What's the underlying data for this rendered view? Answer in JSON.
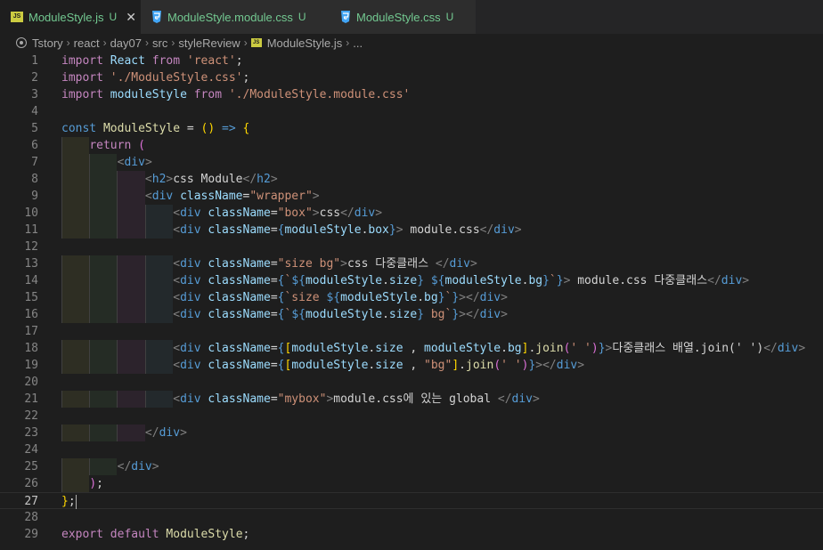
{
  "tabs": [
    {
      "label": "ModuleStyle.js",
      "badge": "U",
      "icon": "js-file-icon",
      "active": true,
      "close": "✕"
    },
    {
      "label": "ModuleStyle.module.css",
      "badge": "U",
      "icon": "css-file-icon",
      "active": false
    },
    {
      "label": "ModuleStyle.css",
      "badge": "U",
      "icon": "css-file-icon",
      "active": false
    }
  ],
  "breadcrumb": [
    "Tstory",
    "react",
    "day07",
    "src",
    "styleReview",
    "ModuleStyle.js",
    "..."
  ],
  "colors": {
    "editor_bg": "#1e1e1e",
    "tab_modified": "#73c991",
    "keyword": "#c586c0",
    "string": "#ce9178",
    "variable": "#9cdcfe"
  },
  "current_line": 27,
  "lines": [
    {
      "n": "1",
      "tokens": [
        [
          "kw",
          "import"
        ],
        [
          "txt",
          " "
        ],
        [
          "var",
          "React"
        ],
        [
          "txt",
          " "
        ],
        [
          "kw",
          "from"
        ],
        [
          "txt",
          " "
        ],
        [
          "str",
          "'react'"
        ],
        [
          "txt",
          ";"
        ]
      ]
    },
    {
      "n": "2",
      "tokens": [
        [
          "kw",
          "import"
        ],
        [
          "txt",
          " "
        ],
        [
          "str",
          "'./ModuleStyle.css'"
        ],
        [
          "txt",
          ";"
        ]
      ]
    },
    {
      "n": "3",
      "tokens": [
        [
          "kw",
          "import"
        ],
        [
          "txt",
          " "
        ],
        [
          "var",
          "moduleStyle"
        ],
        [
          "txt",
          " "
        ],
        [
          "kw",
          "from"
        ],
        [
          "txt",
          " "
        ],
        [
          "str",
          "'./ModuleStyle.module.css'"
        ]
      ]
    },
    {
      "n": "4",
      "tokens": []
    },
    {
      "n": "5",
      "tokens": [
        [
          "kw2",
          "const"
        ],
        [
          "txt",
          " "
        ],
        [
          "fn",
          "ModuleStyle"
        ],
        [
          "txt",
          " = "
        ],
        [
          "brk",
          "()"
        ],
        [
          "txt",
          " "
        ],
        [
          "kw2",
          "=>"
        ],
        [
          "txt",
          " "
        ],
        [
          "brk",
          "{"
        ]
      ]
    },
    {
      "n": "6",
      "tokens": [
        [
          "txt",
          "    "
        ],
        [
          "kw",
          "return"
        ],
        [
          "txt",
          " "
        ],
        [
          "brk2",
          "("
        ]
      ]
    },
    {
      "n": "7",
      "tokens": [
        [
          "txt",
          "        "
        ],
        [
          "ang",
          "<"
        ],
        [
          "tag",
          "div"
        ],
        [
          "ang",
          ">"
        ]
      ]
    },
    {
      "n": "8",
      "tokens": [
        [
          "txt",
          "            "
        ],
        [
          "ang",
          "<"
        ],
        [
          "tag",
          "h2"
        ],
        [
          "ang",
          ">"
        ],
        [
          "txt",
          "css Module"
        ],
        [
          "ang",
          "</"
        ],
        [
          "tag",
          "h2"
        ],
        [
          "ang",
          ">"
        ]
      ]
    },
    {
      "n": "9",
      "tokens": [
        [
          "txt",
          "            "
        ],
        [
          "ang",
          "<"
        ],
        [
          "tag",
          "div"
        ],
        [
          "txt",
          " "
        ],
        [
          "attr",
          "className"
        ],
        [
          "txt",
          "="
        ],
        [
          "str",
          "\"wrapper\""
        ],
        [
          "ang",
          ">"
        ]
      ]
    },
    {
      "n": "10",
      "tokens": [
        [
          "txt",
          "                "
        ],
        [
          "ang",
          "<"
        ],
        [
          "tag",
          "div"
        ],
        [
          "txt",
          " "
        ],
        [
          "attr",
          "className"
        ],
        [
          "txt",
          "="
        ],
        [
          "str",
          "\"box\""
        ],
        [
          "ang",
          ">"
        ],
        [
          "txt",
          "css"
        ],
        [
          "ang",
          "</"
        ],
        [
          "tag",
          "div"
        ],
        [
          "ang",
          ">"
        ]
      ]
    },
    {
      "n": "11",
      "tokens": [
        [
          "txt",
          "                "
        ],
        [
          "ang",
          "<"
        ],
        [
          "tag",
          "div"
        ],
        [
          "txt",
          " "
        ],
        [
          "attr",
          "className"
        ],
        [
          "txt",
          "="
        ],
        [
          "tpl",
          "{"
        ],
        [
          "var",
          "moduleStyle"
        ],
        [
          "txt",
          "."
        ],
        [
          "var",
          "box"
        ],
        [
          "tpl",
          "}"
        ],
        [
          "ang",
          ">"
        ],
        [
          "txt",
          " module.css"
        ],
        [
          "ang",
          "</"
        ],
        [
          "tag",
          "div"
        ],
        [
          "ang",
          ">"
        ]
      ]
    },
    {
      "n": "12",
      "tokens": []
    },
    {
      "n": "13",
      "tokens": [
        [
          "txt",
          "                "
        ],
        [
          "ang",
          "<"
        ],
        [
          "tag",
          "div"
        ],
        [
          "txt",
          " "
        ],
        [
          "attr",
          "className"
        ],
        [
          "txt",
          "="
        ],
        [
          "str",
          "\"size bg\""
        ],
        [
          "ang",
          ">"
        ],
        [
          "txt",
          "css 다중클래스 "
        ],
        [
          "ang",
          "</"
        ],
        [
          "tag",
          "div"
        ],
        [
          "ang",
          ">"
        ]
      ]
    },
    {
      "n": "14",
      "tokens": [
        [
          "txt",
          "                "
        ],
        [
          "ang",
          "<"
        ],
        [
          "tag",
          "div"
        ],
        [
          "txt",
          " "
        ],
        [
          "attr",
          "className"
        ],
        [
          "txt",
          "="
        ],
        [
          "tpl",
          "{"
        ],
        [
          "str",
          "`"
        ],
        [
          "tpl",
          "${"
        ],
        [
          "var",
          "moduleStyle"
        ],
        [
          "txt",
          "."
        ],
        [
          "var",
          "size"
        ],
        [
          "tpl",
          "}"
        ],
        [
          "str",
          " "
        ],
        [
          "tpl",
          "${"
        ],
        [
          "var",
          "moduleStyle"
        ],
        [
          "txt",
          "."
        ],
        [
          "var",
          "bg"
        ],
        [
          "tpl",
          "}"
        ],
        [
          "str",
          "`"
        ],
        [
          "tpl",
          "}"
        ],
        [
          "ang",
          ">"
        ],
        [
          "txt",
          " module.css 다중클래스"
        ],
        [
          "ang",
          "</"
        ],
        [
          "tag",
          "div"
        ],
        [
          "ang",
          ">"
        ]
      ]
    },
    {
      "n": "15",
      "tokens": [
        [
          "txt",
          "                "
        ],
        [
          "ang",
          "<"
        ],
        [
          "tag",
          "div"
        ],
        [
          "txt",
          " "
        ],
        [
          "attr",
          "className"
        ],
        [
          "txt",
          "="
        ],
        [
          "tpl",
          "{"
        ],
        [
          "str",
          "`size "
        ],
        [
          "tpl",
          "${"
        ],
        [
          "var",
          "moduleStyle"
        ],
        [
          "txt",
          "."
        ],
        [
          "var",
          "bg"
        ],
        [
          "tpl",
          "}"
        ],
        [
          "str",
          "`"
        ],
        [
          "tpl",
          "}"
        ],
        [
          "ang",
          "></"
        ],
        [
          "tag",
          "div"
        ],
        [
          "ang",
          ">"
        ]
      ]
    },
    {
      "n": "16",
      "tokens": [
        [
          "txt",
          "                "
        ],
        [
          "ang",
          "<"
        ],
        [
          "tag",
          "div"
        ],
        [
          "txt",
          " "
        ],
        [
          "attr",
          "className"
        ],
        [
          "txt",
          "="
        ],
        [
          "tpl",
          "{"
        ],
        [
          "str",
          "`"
        ],
        [
          "tpl",
          "${"
        ],
        [
          "var",
          "moduleStyle"
        ],
        [
          "txt",
          "."
        ],
        [
          "var",
          "size"
        ],
        [
          "tpl",
          "}"
        ],
        [
          "str",
          " bg`"
        ],
        [
          "tpl",
          "}"
        ],
        [
          "ang",
          "></"
        ],
        [
          "tag",
          "div"
        ],
        [
          "ang",
          ">"
        ]
      ]
    },
    {
      "n": "17",
      "tokens": []
    },
    {
      "n": "18",
      "tokens": [
        [
          "txt",
          "                "
        ],
        [
          "ang",
          "<"
        ],
        [
          "tag",
          "div"
        ],
        [
          "txt",
          " "
        ],
        [
          "attr",
          "className"
        ],
        [
          "txt",
          "="
        ],
        [
          "tpl",
          "{"
        ],
        [
          "brk",
          "["
        ],
        [
          "var",
          "moduleStyle"
        ],
        [
          "txt",
          "."
        ],
        [
          "var",
          "size"
        ],
        [
          "txt",
          " , "
        ],
        [
          "var",
          "moduleStyle"
        ],
        [
          "txt",
          "."
        ],
        [
          "var",
          "bg"
        ],
        [
          "brk",
          "]"
        ],
        [
          "txt",
          "."
        ],
        [
          "fn",
          "join"
        ],
        [
          "brk2",
          "("
        ],
        [
          "str",
          "' '"
        ],
        [
          "brk2",
          ")"
        ],
        [
          "tpl",
          "}"
        ],
        [
          "ang",
          ">"
        ],
        [
          "txt",
          "다중클래스 배열.join(' ')"
        ],
        [
          "ang",
          "</"
        ],
        [
          "tag",
          "div"
        ],
        [
          "ang",
          ">"
        ]
      ]
    },
    {
      "n": "19",
      "tokens": [
        [
          "txt",
          "                "
        ],
        [
          "ang",
          "<"
        ],
        [
          "tag",
          "div"
        ],
        [
          "txt",
          " "
        ],
        [
          "attr",
          "className"
        ],
        [
          "txt",
          "="
        ],
        [
          "tpl",
          "{"
        ],
        [
          "brk",
          "["
        ],
        [
          "var",
          "moduleStyle"
        ],
        [
          "txt",
          "."
        ],
        [
          "var",
          "size"
        ],
        [
          "txt",
          " , "
        ],
        [
          "str",
          "\"bg\""
        ],
        [
          "brk",
          "]"
        ],
        [
          "txt",
          "."
        ],
        [
          "fn",
          "join"
        ],
        [
          "brk2",
          "("
        ],
        [
          "str",
          "' '"
        ],
        [
          "brk2",
          ")"
        ],
        [
          "tpl",
          "}"
        ],
        [
          "ang",
          "></"
        ],
        [
          "tag",
          "div"
        ],
        [
          "ang",
          ">"
        ]
      ]
    },
    {
      "n": "20",
      "tokens": []
    },
    {
      "n": "21",
      "tokens": [
        [
          "txt",
          "                "
        ],
        [
          "ang",
          "<"
        ],
        [
          "tag",
          "div"
        ],
        [
          "txt",
          " "
        ],
        [
          "attr",
          "className"
        ],
        [
          "txt",
          "="
        ],
        [
          "str",
          "\"mybox\""
        ],
        [
          "ang",
          ">"
        ],
        [
          "txt",
          "module.css에 있는 global "
        ],
        [
          "ang",
          "</"
        ],
        [
          "tag",
          "div"
        ],
        [
          "ang",
          ">"
        ]
      ]
    },
    {
      "n": "22",
      "tokens": []
    },
    {
      "n": "23",
      "tokens": [
        [
          "txt",
          "            "
        ],
        [
          "ang",
          "</"
        ],
        [
          "tag",
          "div"
        ],
        [
          "ang",
          ">"
        ]
      ]
    },
    {
      "n": "24",
      "tokens": []
    },
    {
      "n": "25",
      "tokens": [
        [
          "txt",
          "        "
        ],
        [
          "ang",
          "</"
        ],
        [
          "tag",
          "div"
        ],
        [
          "ang",
          ">"
        ]
      ]
    },
    {
      "n": "26",
      "tokens": [
        [
          "txt",
          "    "
        ],
        [
          "brk2",
          ")"
        ],
        [
          "txt",
          ";"
        ]
      ]
    },
    {
      "n": "27",
      "tokens": [
        [
          "brk",
          "}"
        ],
        [
          "txt",
          ";"
        ]
      ]
    },
    {
      "n": "28",
      "tokens": []
    },
    {
      "n": "29",
      "tokens": [
        [
          "kw",
          "export"
        ],
        [
          "txt",
          " "
        ],
        [
          "kw",
          "default"
        ],
        [
          "txt",
          " "
        ],
        [
          "fn",
          "ModuleStyle"
        ],
        [
          "txt",
          ";"
        ]
      ]
    }
  ]
}
